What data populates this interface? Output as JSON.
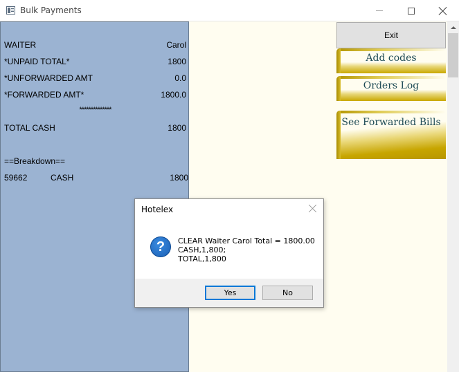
{
  "window": {
    "title": "Bulk Payments"
  },
  "receipt": {
    "rows": [
      {
        "label": "WAITER",
        "value": "Carol"
      },
      {
        "label": "*UNPAID TOTAL*",
        "value": "1800"
      },
      {
        "label": "*UNFORWARDED AMT",
        "value": "0.0"
      },
      {
        "label": "*FORWARDED AMT*",
        "value": "1800.0"
      }
    ],
    "separator": "**************",
    "total_cash": {
      "label": "TOTAL CASH",
      "value": "1800"
    },
    "breakdown_header": "==Breakdown==",
    "breakdown": [
      {
        "code": "59662",
        "type": "CASH",
        "amount": "1800"
      }
    ]
  },
  "actions": {
    "exit": "Exit",
    "add_codes": "Add codes",
    "orders_log": "Orders Log",
    "see_forwarded_bills": "See Forwarded Bills"
  },
  "dialog": {
    "title": "Hotelex",
    "icon": "question-icon",
    "message_lines": [
      "CLEAR Waiter Carol Total = 1800.00",
      "CASH,1,800;",
      "TOTAL,1,800"
    ],
    "yes": "Yes",
    "no": "No"
  },
  "colors": {
    "receipt_bg": "#9bb3d2",
    "client_bg": "#fffdf0",
    "gold": "#c9a800",
    "button_text": "#1d4a55",
    "focus_border": "#0078d7"
  }
}
